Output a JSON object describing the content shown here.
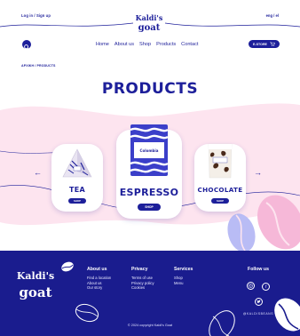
{
  "header": {
    "auth_label": "Log in / Sign up",
    "lang_label": "eng / el",
    "logo_text_1": "Kaldi's",
    "logo_text_2": "goat"
  },
  "nav": {
    "links": [
      "Home",
      "About us",
      "Shop",
      "Products",
      "Contact"
    ],
    "store_label": "E-STORE"
  },
  "breadcrumb": {
    "home": "ΑΡΧΙΚΗ",
    "separator": "/",
    "current": "PRODUCTS"
  },
  "page": {
    "title": "PRODUCTS"
  },
  "products": [
    {
      "name": "TEA",
      "button": "SHOP",
      "package_label": ""
    },
    {
      "name": "ESPRESSO",
      "button": "SHOP",
      "package_label": "Colombia"
    },
    {
      "name": "CHOCOLATE",
      "button": "SHOP",
      "package_label": ""
    }
  ],
  "footer": {
    "logo_text_1": "Kaldi's",
    "logo_text_2": "goat",
    "about": {
      "title": "About us",
      "items": [
        "Find a location",
        "About us",
        "Our story"
      ]
    },
    "privacy": {
      "title": "Privacy",
      "items": [
        "Terms of use",
        "Privacy policy",
        "Cookies"
      ]
    },
    "services": {
      "title": "Services",
      "items": [
        "Shop",
        "Menu"
      ]
    },
    "follow": {
      "title": "Follow us",
      "handle": "@KALDISBEANS",
      "icons": [
        "instagram-icon",
        "facebook-icon",
        "twitter-icon"
      ]
    },
    "copyright": "© 2024 copyright Kaldi's Goat"
  },
  "colors": {
    "navy": "#1d1f9a",
    "pink": "#fde4ef",
    "footer": "#1a1c8e",
    "bean_blue": "#b9bcf5",
    "bean_pink": "#f6b8d8"
  }
}
